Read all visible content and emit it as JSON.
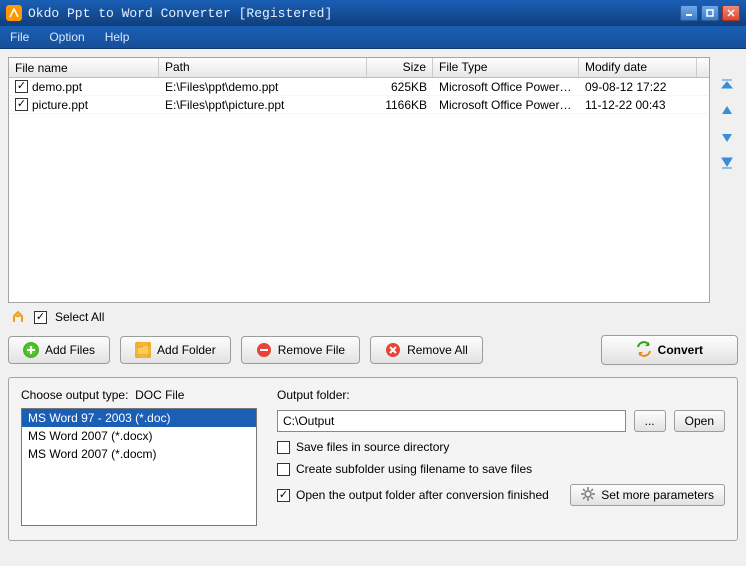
{
  "window": {
    "title": "Okdo Ppt to Word Converter [Registered]"
  },
  "menu": {
    "file": "File",
    "option": "Option",
    "help": "Help"
  },
  "table": {
    "headers": {
      "name": "File name",
      "path": "Path",
      "size": "Size",
      "type": "File Type",
      "date": "Modify date"
    },
    "rows": [
      {
        "checked": true,
        "name": "demo.ppt",
        "path": "E:\\Files\\ppt\\demo.ppt",
        "size": "625KB",
        "type": "Microsoft Office PowerP...",
        "date": "09-08-12 17:22"
      },
      {
        "checked": true,
        "name": "picture.ppt",
        "path": "E:\\Files\\ppt\\picture.ppt",
        "size": "1166KB",
        "type": "Microsoft Office PowerP...",
        "date": "11-12-22 00:43"
      }
    ]
  },
  "selectAll": {
    "label": "Select All",
    "checked": true
  },
  "buttons": {
    "addFiles": "Add Files",
    "addFolder": "Add Folder",
    "removeFile": "Remove File",
    "removeAll": "Remove All",
    "convert": "Convert"
  },
  "outputType": {
    "label": "Choose output type:",
    "current": "DOC File",
    "options": [
      {
        "label": "MS Word 97 - 2003 (*.doc)",
        "selected": true
      },
      {
        "label": "MS Word 2007 (*.docx)",
        "selected": false
      },
      {
        "label": "MS Word 2007 (*.docm)",
        "selected": false
      }
    ]
  },
  "outputFolder": {
    "label": "Output folder:",
    "value": "C:\\Output",
    "browse": "...",
    "open": "Open"
  },
  "checks": {
    "saveSource": {
      "label": "Save files in source directory",
      "checked": false
    },
    "subfolder": {
      "label": "Create subfolder using filename to save files",
      "checked": false
    },
    "openAfter": {
      "label": "Open the output folder after conversion finished",
      "checked": true
    }
  },
  "moreParams": "Set more parameters"
}
